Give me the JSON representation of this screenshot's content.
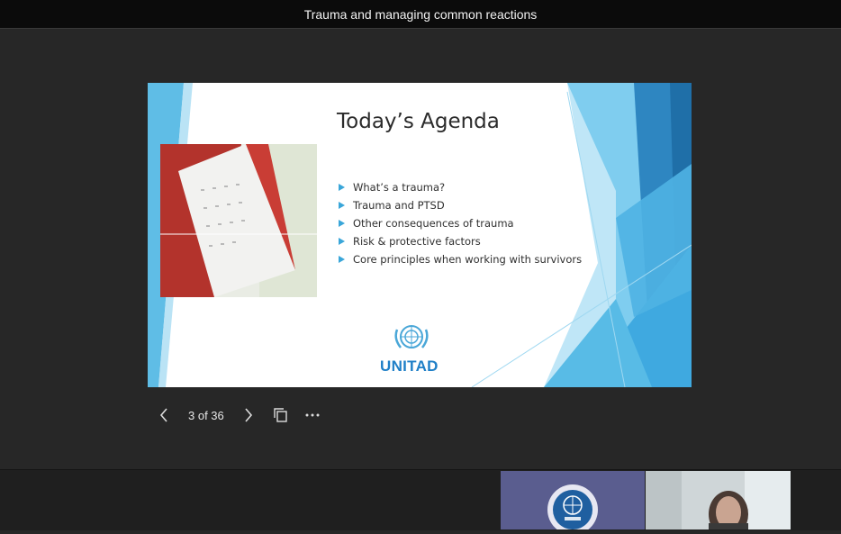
{
  "window": {
    "title": "Trauma and managing common reactions"
  },
  "slide": {
    "title": "Today’s Agenda",
    "items": [
      "What’s a trauma?",
      "Trauma and PTSD",
      "Other consequences of trauma",
      "Risk & protective factors",
      "Core principles when working with survivors"
    ],
    "brand": "UNITAD",
    "colors": {
      "accent": "#3aa6d9",
      "brand": "#1f7fc7"
    }
  },
  "controls": {
    "page_indicator": "3 of 36",
    "prev_icon": "chevron-left-icon",
    "next_icon": "chevron-right-icon",
    "layout_icon": "slides-grid-icon",
    "more_icon": "more-options-icon"
  },
  "participants": [
    {
      "kind": "logo-tile",
      "icon": "un-emblem-icon"
    },
    {
      "kind": "video-tile",
      "icon": "participant-video"
    }
  ]
}
